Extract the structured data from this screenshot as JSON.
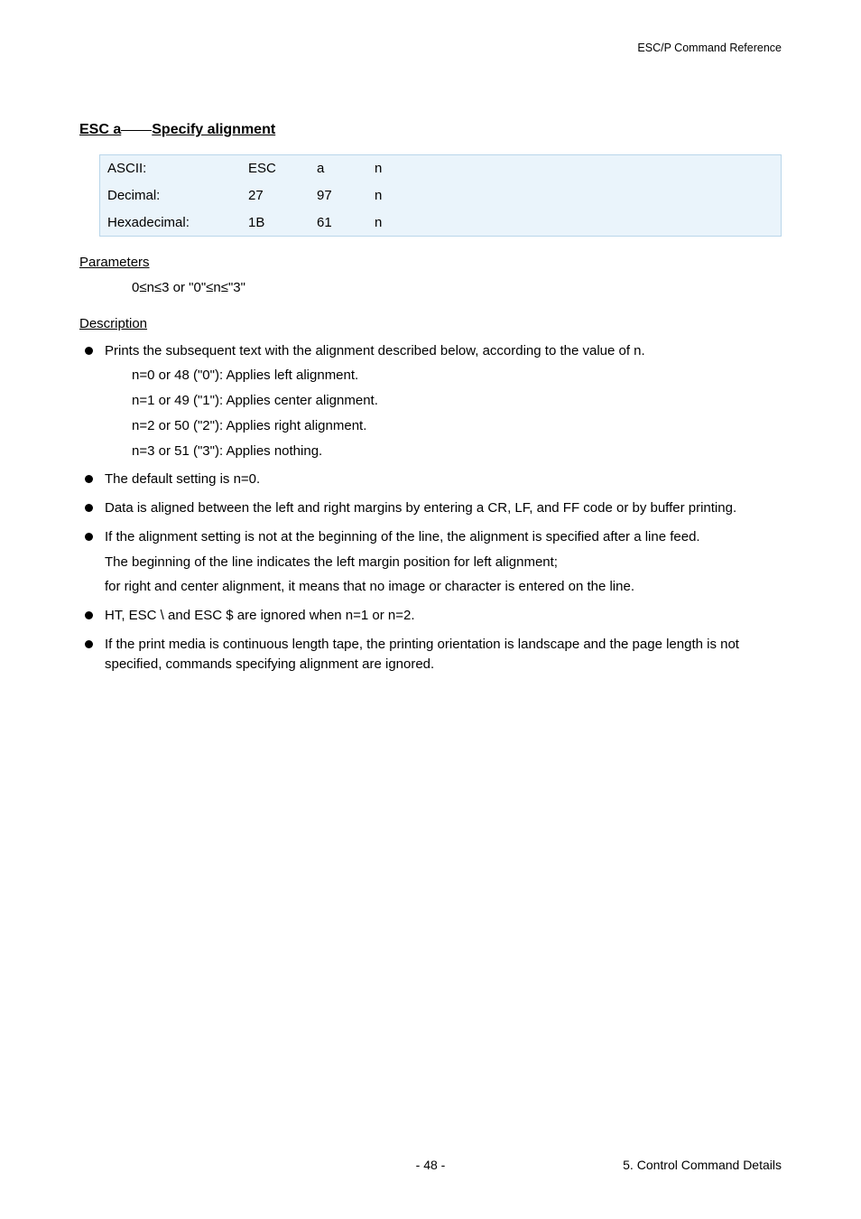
{
  "header": {
    "right": "ESC/P Command Reference"
  },
  "title": {
    "cmd": "ESC a",
    "text": "Specify alignment"
  },
  "codes": {
    "rows": [
      {
        "label": "ASCII:",
        "c1": "ESC",
        "c2": "a",
        "c3": "n"
      },
      {
        "label": "Decimal:",
        "c1": "27",
        "c2": "97",
        "c3": "n"
      },
      {
        "label": "Hexadecimal:",
        "c1": "1B",
        "c2": "61",
        "c3": "n"
      }
    ]
  },
  "parameters": {
    "heading": "Parameters",
    "line": "0≤n≤3 or \"0\"≤n≤\"3\""
  },
  "description": {
    "heading": "Description",
    "bullets": [
      {
        "text": "Prints the subsequent text with the alignment described below, according to the value of n.",
        "sub": [
          "n=0 or 48 (\"0\"): Applies left alignment.",
          "n=1 or 49 (\"1\"): Applies center alignment.",
          "n=2 or 50 (\"2\"): Applies right alignment.",
          "n=3 or 51 (\"3\"): Applies nothing."
        ]
      },
      {
        "text": "The default setting is n=0."
      },
      {
        "text": "Data is aligned between the left and right margins by entering a CR, LF, and FF code or by buffer printing."
      },
      {
        "text": "If the alignment setting is not at the beginning of the line, the alignment is specified after a line feed.",
        "paras": [
          "The beginning of the line indicates the left margin position for left alignment;",
          "for right and center alignment, it means that no image or character is entered on the line."
        ]
      },
      {
        "text": "HT, ESC \\ and ESC $ are ignored when n=1 or n=2."
      },
      {
        "text": "If the print media is continuous length tape, the printing orientation is landscape and the page length is not specified, commands specifying alignment are ignored."
      }
    ]
  },
  "footer": {
    "page": "- 48 -",
    "right": "5. Control Command Details"
  }
}
